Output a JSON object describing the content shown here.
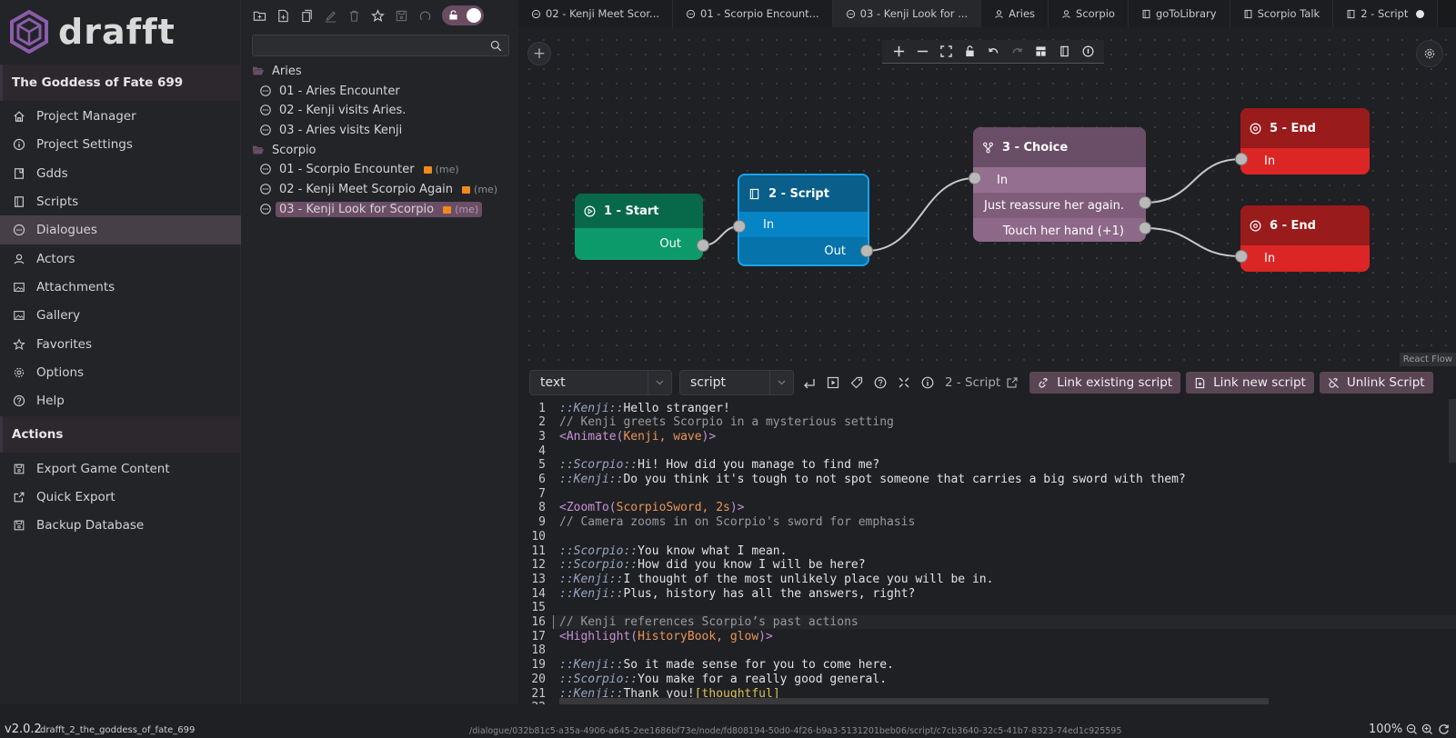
{
  "app": {
    "logo_text": "drafft",
    "accent": "#8a5cab"
  },
  "sidebar": {
    "project_title": "The Goddess of Fate 699",
    "items": [
      {
        "label": "Project Manager",
        "icon": "home-icon"
      },
      {
        "label": "Project Settings",
        "icon": "info-icon"
      },
      {
        "label": "Gdds",
        "icon": "bookmark-icon"
      },
      {
        "label": "Scripts",
        "icon": "script-icon"
      },
      {
        "label": "Dialogues",
        "icon": "chat-icon",
        "active": true
      },
      {
        "label": "Actors",
        "icon": "user-icon"
      },
      {
        "label": "Attachments",
        "icon": "image-icon"
      },
      {
        "label": "Gallery",
        "icon": "image-icon"
      },
      {
        "label": "Favorites",
        "icon": "star-icon"
      },
      {
        "label": "Options",
        "icon": "gear-icon"
      },
      {
        "label": "Help",
        "icon": "help-icon"
      }
    ],
    "actions_title": "Actions",
    "actions": [
      {
        "label": "Export Game Content",
        "icon": "save-icon"
      },
      {
        "label": "Quick Export",
        "icon": "external-link-icon"
      },
      {
        "label": "Backup Database",
        "icon": "save-icon"
      }
    ]
  },
  "tree": {
    "search_placeholder": "",
    "lock_toggle_on": true,
    "folders": [
      {
        "label": "Aries",
        "items": [
          {
            "label": "01 - Aries Encounter"
          },
          {
            "label": "02 - Kenji visits Aries."
          },
          {
            "label": "03 - Aries visits Kenji"
          }
        ]
      },
      {
        "label": "Scorpio",
        "items": [
          {
            "label": "01 - Scorpio Encounter",
            "lock": "(me)"
          },
          {
            "label": "02 - Kenji Meet Scorpio Again",
            "lock": "(me)"
          },
          {
            "label": "03 - Kenji Look for Scorpio",
            "lock": "(me)",
            "selected": true
          }
        ]
      }
    ]
  },
  "tabs": [
    {
      "label": "02 - Kenji Meet Scor...",
      "icon": "chat-icon"
    },
    {
      "label": "01 - Scorpio Encount...",
      "icon": "chat-icon"
    },
    {
      "label": "03 - Kenji Look for ...",
      "icon": "chat-icon",
      "active": true
    },
    {
      "label": "Aries",
      "icon": "user-icon"
    },
    {
      "label": "Scorpio",
      "icon": "user-icon"
    },
    {
      "label": "goToLibrary",
      "icon": "script-icon"
    },
    {
      "label": "Scorpio Talk",
      "icon": "script-icon"
    },
    {
      "label": "2 - Script",
      "icon": "script-icon",
      "unsaved": true
    }
  ],
  "flow": {
    "attribution": "React Flow",
    "nodes": {
      "start": {
        "title": "1 - Start",
        "out": "Out",
        "color": "#0c9a6a",
        "header": "#07684a"
      },
      "script": {
        "title": "2 - Script",
        "in": "In",
        "out": "Out",
        "color": "#0584c6",
        "header": "#0a5e8a",
        "border": "#1aa3ec"
      },
      "choice": {
        "title": "3 - Choice",
        "in": "In",
        "options": [
          "Just reassure her again.",
          "Touch her hand (+1)"
        ],
        "color": "#8e6889",
        "header": "#6a4d66"
      },
      "end5": {
        "title": "5 - End",
        "in": "In",
        "color": "#dc2626",
        "header": "#991b1b"
      },
      "end6": {
        "title": "6 - End",
        "in": "In",
        "color": "#dc2626",
        "header": "#991b1b"
      }
    }
  },
  "editor_bar": {
    "type_select": "text",
    "mode_select": "script",
    "script_name": "2 - Script",
    "link_existing": "Link existing script",
    "link_new": "Link new script",
    "unlink": "Unlink Script"
  },
  "code": [
    [
      [
        "spk",
        "::Kenji::"
      ],
      [
        "txt",
        "Hello stranger!"
      ]
    ],
    [
      [
        "cmt",
        "// Kenji greets Scorpio in a mysterious setting"
      ]
    ],
    [
      [
        "tag",
        "<Animate("
      ],
      [
        "arg",
        "Kenji, wave"
      ],
      [
        "tag",
        ")>"
      ]
    ],
    [],
    [
      [
        "spk",
        "::Scorpio::"
      ],
      [
        "txt",
        "Hi! How did you manage to find me?"
      ]
    ],
    [
      [
        "spk",
        "::Kenji::"
      ],
      [
        "txt",
        "Do you think it's tough to not spot someone that carries a big sword with them?"
      ]
    ],
    [],
    [
      [
        "tag",
        "<ZoomTo("
      ],
      [
        "arg",
        "ScorpioSword, 2s"
      ],
      [
        "tag",
        ")>"
      ]
    ],
    [
      [
        "cmt",
        "// Camera zooms in on Scorpio's sword for emphasis"
      ]
    ],
    [],
    [
      [
        "spk",
        "::Scorpio::"
      ],
      [
        "txt",
        "You know what I mean."
      ]
    ],
    [
      [
        "spk",
        "::Scorpio::"
      ],
      [
        "txt",
        "How did you know I will be here?"
      ]
    ],
    [
      [
        "spk",
        "::Kenji::"
      ],
      [
        "txt",
        "I thought of the most unlikely place you will be in."
      ]
    ],
    [
      [
        "spk",
        "::Kenji::"
      ],
      [
        "txt",
        "Plus, history has all the answers, right?"
      ]
    ],
    [],
    [
      [
        "cmt",
        "// Kenji references Scorpio’s past actions"
      ]
    ],
    [
      [
        "tag",
        "<Highlight("
      ],
      [
        "arg",
        "HistoryBook, glow"
      ],
      [
        "tag",
        ")>"
      ]
    ],
    [],
    [
      [
        "spk",
        "::Kenji::"
      ],
      [
        "txt",
        "So it made sense for you to come here."
      ]
    ],
    [
      [
        "spk",
        "::Scorpio::"
      ],
      [
        "txt",
        "You make for a really good general."
      ]
    ],
    [
      [
        "spk",
        "::Kenji::"
      ],
      [
        "txt",
        "Thank you!"
      ],
      [
        "emo",
        "[thoughtful]"
      ]
    ],
    []
  ],
  "current_line": 16,
  "status": {
    "version": "v2.0.2",
    "database": "drafft_2_the_goddess_of_fate_699",
    "path": "/dialogue/032b81c5-a35a-4906-a645-2ee1686bf73e/node/fd808194-50d0-4f26-b9a3-5131201beb06/script/c7cb3640-32c5-41b7-8323-74ed1c925595",
    "zoom": "100%"
  }
}
